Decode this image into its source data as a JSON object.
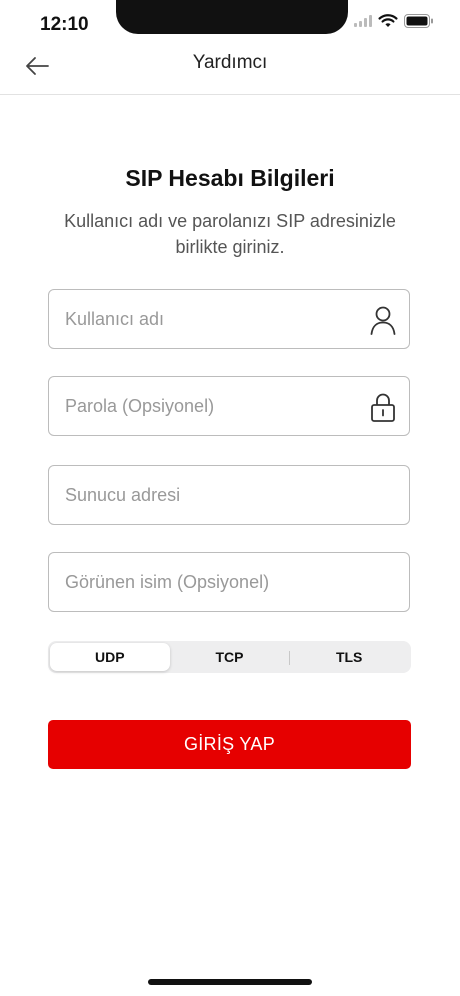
{
  "status_bar": {
    "time": "12:10"
  },
  "nav": {
    "title": "Yardımcı",
    "back_icon": "arrow-left-icon"
  },
  "form": {
    "title": "SIP Hesabı Bilgileri",
    "description": "Kullanıcı adı ve parolanızı SIP adresinizle birlikte giriniz.",
    "fields": [
      {
        "placeholder": "Kullanıcı adı",
        "value": "",
        "icon": "user-icon"
      },
      {
        "placeholder": "Parola (Opsiyonel)",
        "value": "",
        "icon": "lock-icon"
      },
      {
        "placeholder": "Sunucu adresi",
        "value": ""
      },
      {
        "placeholder": "Görünen isim (Opsiyonel)",
        "value": ""
      }
    ],
    "transport": {
      "options": [
        "UDP",
        "TCP",
        "TLS"
      ],
      "selected": "UDP"
    },
    "submit_label": "GİRİŞ YAP"
  },
  "colors": {
    "accent": "#e60000",
    "border": "#bcbcbc",
    "segment_bg": "#eeeeef"
  }
}
